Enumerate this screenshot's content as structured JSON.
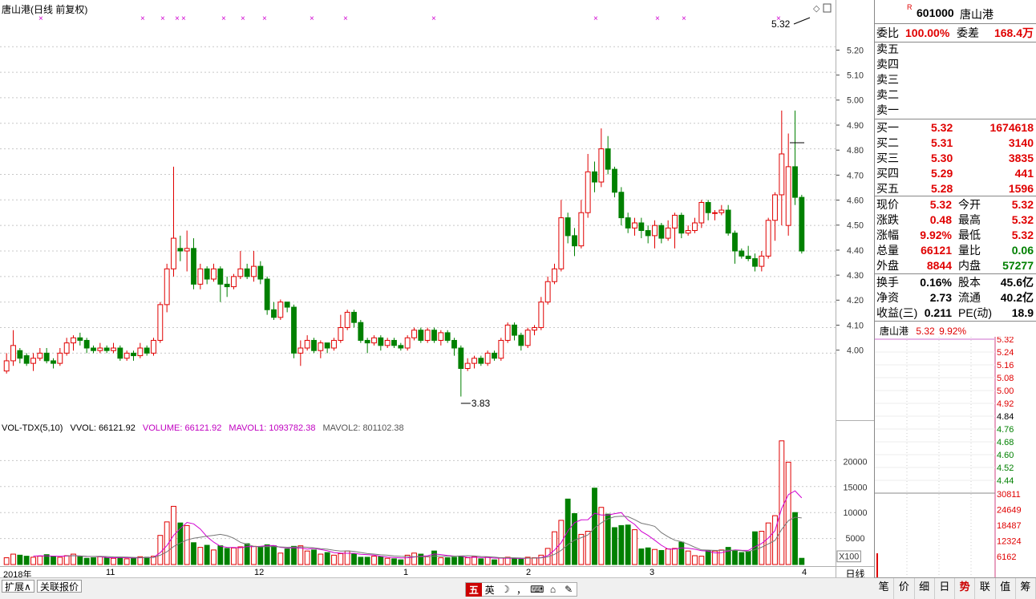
{
  "chart_title": "唐山港(日线 前复权)",
  "last_price_tag": "5.32",
  "low_tag": "3.83",
  "price_ticks": [
    "5.20",
    "5.10",
    "5.00",
    "4.90",
    "4.80",
    "4.70",
    "4.60",
    "4.50",
    "4.40",
    "4.30",
    "4.20",
    "4.10",
    "4.00"
  ],
  "vol_legend": {
    "name": "VOL-TDX(5,10)",
    "vvol": "VVOL: 66121.92",
    "volume": "VOLUME: 66121.92",
    "mavol1": "MAVOL1: 1093782.38",
    "mavol2": "MAVOL2: 801102.38"
  },
  "vol_ticks": [
    "20000",
    "15000",
    "10000",
    "5000"
  ],
  "vol_unit": "X100",
  "date_labels": [
    "2018年",
    "11",
    "12",
    "1",
    "2",
    "3",
    "4"
  ],
  "period_label": "日线",
  "bottom_tabs": [
    "扩展∧",
    "关联报价"
  ],
  "ime": [
    "五",
    "英",
    "☽",
    "，",
    "⌨",
    "⌂",
    "✎"
  ],
  "quote": {
    "badge": "R",
    "code": "601000",
    "name": "唐山港",
    "weibi_label": "委比",
    "weibi": "100.00%",
    "weicha_label": "委差",
    "weicha": "168.4万",
    "sell": [
      "卖五",
      "卖四",
      "卖三",
      "卖二",
      "卖一"
    ],
    "buy": [
      {
        "label": "买一",
        "price": "5.32",
        "vol": "1674618"
      },
      {
        "label": "买二",
        "price": "5.31",
        "vol": "3140"
      },
      {
        "label": "买三",
        "price": "5.30",
        "vol": "3835"
      },
      {
        "label": "买四",
        "price": "5.29",
        "vol": "441"
      },
      {
        "label": "买五",
        "price": "5.28",
        "vol": "1596"
      }
    ],
    "stats": [
      {
        "l1": "现价",
        "v1": "5.32",
        "l2": "今开",
        "v2": "5.32"
      },
      {
        "l1": "涨跌",
        "v1": "0.48",
        "l2": "最高",
        "v2": "5.32"
      },
      {
        "l1": "涨幅",
        "v1": "9.92%",
        "l2": "最低",
        "v2": "5.32"
      },
      {
        "l1": "总量",
        "v1": "66121",
        "l2": "量比",
        "v2": "0.06"
      },
      {
        "l1": "外盘",
        "v1": "8844",
        "l2": "内盘",
        "v2": "57277"
      }
    ],
    "extra": [
      {
        "l1": "换手",
        "v1": "0.16%",
        "l2": "股本",
        "v2": "45.6亿"
      },
      {
        "l1": "净资",
        "v1": "2.73",
        "l2": "流通",
        "v2": "40.2亿"
      },
      {
        "l1": "收益(三)",
        "v1": "0.211",
        "l2": "PE(动)",
        "v2": "18.9"
      }
    ],
    "mini_title_name": "唐山港",
    "mini_title_price": "5.32",
    "mini_title_pct": "9.92%",
    "mini_price_ticks": [
      "5.32",
      "5.24",
      "5.16",
      "5.08",
      "5.00",
      "4.92",
      "4.84",
      "4.76",
      "4.68",
      "4.60",
      "4.52",
      "4.44"
    ],
    "mini_vol_ticks": [
      "30811",
      "24649",
      "18487",
      "12324",
      "6162"
    ],
    "tabs": [
      "笔",
      "价",
      "细",
      "日",
      "势",
      "联",
      "值",
      "筹"
    ]
  },
  "chart_data": {
    "type": "candlestick",
    "title": "唐山港(日线 前复权)",
    "ylim": [
      3.75,
      5.32
    ],
    "candles": [
      [
        3.93,
        3.97,
        3.92,
        4.0
      ],
      [
        3.97,
        4.03,
        3.95,
        4.09
      ],
      [
        4.01,
        3.98,
        3.96,
        4.02
      ],
      [
        3.99,
        3.96,
        3.95,
        4.0
      ],
      [
        3.96,
        3.98,
        3.93,
        4.0
      ],
      [
        3.98,
        4.0,
        3.97,
        4.02
      ],
      [
        4.0,
        3.97,
        3.96,
        4.02
      ],
      [
        3.97,
        3.96,
        3.94,
        3.98
      ],
      [
        3.96,
        4.0,
        3.95,
        4.02
      ],
      [
        4.0,
        4.04,
        3.99,
        4.06
      ],
      [
        4.04,
        4.06,
        4.01,
        4.07
      ],
      [
        4.06,
        4.05,
        4.03,
        4.08
      ],
      [
        4.05,
        4.02,
        4.0,
        4.06
      ],
      [
        4.02,
        4.01,
        4.0,
        4.03
      ],
      [
        4.01,
        4.02,
        4.0,
        4.04
      ],
      [
        4.02,
        4.01,
        4.0,
        4.03
      ],
      [
        4.01,
        4.02,
        4.0,
        4.04
      ],
      [
        4.02,
        3.98,
        3.97,
        4.03
      ],
      [
        3.98,
        4.0,
        3.97,
        4.01
      ],
      [
        4.0,
        3.99,
        3.97,
        4.01
      ],
      [
        3.99,
        4.02,
        3.98,
        4.04
      ],
      [
        4.02,
        4.0,
        3.99,
        4.03
      ],
      [
        4.0,
        4.05,
        3.99,
        4.06
      ],
      [
        4.05,
        4.19,
        4.04,
        4.2
      ],
      [
        4.19,
        4.33,
        4.16,
        4.35
      ],
      [
        4.33,
        4.45,
        4.3,
        4.73
      ],
      [
        4.41,
        4.4,
        4.36,
        4.46
      ],
      [
        4.4,
        4.41,
        4.32,
        4.48
      ],
      [
        4.41,
        4.27,
        4.25,
        4.45
      ],
      [
        4.27,
        4.33,
        4.25,
        4.35
      ],
      [
        4.33,
        4.29,
        4.27,
        4.34
      ],
      [
        4.29,
        4.33,
        4.28,
        4.35
      ],
      [
        4.33,
        4.27,
        4.2,
        4.34
      ],
      [
        4.27,
        4.26,
        4.22,
        4.3
      ],
      [
        4.26,
        4.3,
        4.25,
        4.31
      ],
      [
        4.3,
        4.33,
        4.29,
        4.4
      ],
      [
        4.33,
        4.3,
        4.29,
        4.35
      ],
      [
        4.3,
        4.34,
        4.28,
        4.4
      ],
      [
        4.34,
        4.29,
        4.27,
        4.36
      ],
      [
        4.29,
        4.17,
        4.15,
        4.3
      ],
      [
        4.17,
        4.14,
        4.13,
        4.2
      ],
      [
        4.14,
        4.2,
        4.13,
        4.21
      ],
      [
        4.2,
        4.18,
        4.16,
        4.2
      ],
      [
        4.18,
        4.0,
        3.98,
        4.19
      ],
      [
        4.0,
        4.02,
        3.95,
        4.05
      ],
      [
        4.02,
        4.05,
        4.01,
        4.07
      ],
      [
        4.05,
        4.01,
        4.0,
        4.06
      ],
      [
        4.01,
        4.04,
        3.98,
        4.05
      ],
      [
        4.04,
        4.02,
        4.0,
        4.04
      ],
      [
        4.02,
        4.05,
        4.01,
        4.06
      ],
      [
        4.05,
        4.1,
        4.04,
        4.15
      ],
      [
        4.1,
        4.16,
        4.09,
        4.17
      ],
      [
        4.16,
        4.12,
        4.1,
        4.17
      ],
      [
        4.12,
        4.05,
        4.04,
        4.13
      ],
      [
        4.05,
        4.04,
        4.0,
        4.06
      ],
      [
        4.04,
        4.06,
        4.03,
        4.07
      ],
      [
        4.06,
        4.03,
        4.01,
        4.07
      ],
      [
        4.03,
        4.05,
        4.02,
        4.06
      ],
      [
        4.05,
        4.03,
        4.02,
        4.06
      ],
      [
        4.03,
        4.02,
        4.01,
        4.04
      ],
      [
        4.02,
        4.06,
        4.01,
        4.07
      ],
      [
        4.06,
        4.09,
        4.05,
        4.1
      ],
      [
        4.09,
        4.05,
        4.04,
        4.1
      ],
      [
        4.05,
        4.09,
        4.04,
        4.1
      ],
      [
        4.09,
        4.05,
        4.04,
        4.1
      ],
      [
        4.05,
        4.08,
        4.03,
        4.09
      ],
      [
        4.08,
        4.05,
        4.04,
        4.09
      ],
      [
        4.05,
        4.02,
        3.99,
        4.06
      ],
      [
        4.02,
        3.94,
        3.83,
        4.03
      ],
      [
        3.94,
        3.96,
        3.93,
        3.98
      ],
      [
        3.96,
        3.98,
        3.94,
        3.99
      ],
      [
        3.98,
        3.96,
        3.95,
        3.99
      ],
      [
        3.96,
        4.0,
        3.95,
        4.01
      ],
      [
        4.0,
        3.98,
        3.97,
        4.01
      ],
      [
        3.98,
        4.05,
        3.97,
        4.06
      ],
      [
        4.05,
        4.11,
        4.04,
        4.12
      ],
      [
        4.11,
        4.07,
        4.05,
        4.12
      ],
      [
        4.07,
        4.03,
        4.01,
        4.08
      ],
      [
        4.03,
        4.09,
        4.02,
        4.1
      ],
      [
        4.09,
        4.1,
        4.07,
        4.11
      ],
      [
        4.1,
        4.2,
        4.09,
        4.22
      ],
      [
        4.2,
        4.28,
        4.19,
        4.3
      ],
      [
        4.28,
        4.33,
        4.27,
        4.35
      ],
      [
        4.33,
        4.53,
        4.32,
        4.6
      ],
      [
        4.53,
        4.46,
        4.43,
        4.55
      ],
      [
        4.46,
        4.42,
        4.38,
        4.49
      ],
      [
        4.42,
        4.55,
        4.41,
        4.6
      ],
      [
        4.55,
        4.71,
        4.53,
        4.78
      ],
      [
        4.71,
        4.67,
        4.63,
        4.75
      ],
      [
        4.67,
        4.8,
        4.65,
        4.88
      ],
      [
        4.8,
        4.72,
        4.7,
        4.85
      ],
      [
        4.72,
        4.63,
        4.61,
        4.73
      ],
      [
        4.63,
        4.53,
        4.5,
        4.65
      ],
      [
        4.53,
        4.49,
        4.47,
        4.55
      ],
      [
        4.49,
        4.51,
        4.46,
        4.53
      ],
      [
        4.51,
        4.48,
        4.45,
        4.53
      ],
      [
        4.48,
        4.46,
        4.43,
        4.5
      ],
      [
        4.46,
        4.5,
        4.41,
        4.52
      ],
      [
        4.5,
        4.45,
        4.43,
        4.51
      ],
      [
        4.45,
        4.49,
        4.44,
        4.52
      ],
      [
        4.49,
        4.54,
        4.41,
        4.55
      ],
      [
        4.54,
        4.47,
        4.45,
        4.55
      ],
      [
        4.47,
        4.48,
        4.46,
        4.5
      ],
      [
        4.48,
        4.51,
        4.47,
        4.53
      ],
      [
        4.51,
        4.59,
        4.49,
        4.6
      ],
      [
        4.59,
        4.55,
        4.52,
        4.6
      ],
      [
        4.55,
        4.55,
        4.52,
        4.56
      ],
      [
        4.55,
        4.56,
        4.54,
        4.58
      ],
      [
        4.56,
        4.47,
        4.46,
        4.58
      ],
      [
        4.47,
        4.4,
        4.35,
        4.48
      ],
      [
        4.4,
        4.38,
        4.37,
        4.41
      ],
      [
        4.38,
        4.37,
        4.36,
        4.42
      ],
      [
        4.37,
        4.34,
        4.32,
        4.39
      ],
      [
        4.34,
        4.38,
        4.32,
        4.4
      ],
      [
        4.38,
        4.52,
        4.37,
        4.53
      ],
      [
        4.52,
        4.62,
        4.44,
        4.63
      ],
      [
        4.62,
        4.78,
        4.5,
        4.95
      ],
      [
        4.5,
        4.73,
        4.46,
        4.86
      ],
      [
        4.73,
        4.61,
        4.58,
        4.95
      ],
      [
        4.61,
        4.4,
        4.39,
        4.62
      ]
    ],
    "volume": [
      1300,
      2000,
      1800,
      1600,
      1400,
      1600,
      1900,
      1600,
      1400,
      1700,
      2000,
      1500,
      1200,
      1300,
      1500,
      1300,
      1200,
      1400,
      1100,
      1300,
      1500,
      1400,
      1600,
      5600,
      8200,
      11200,
      8000,
      7500,
      4200,
      3300,
      3700,
      2800,
      3600,
      3100,
      3200,
      3400,
      4000,
      3500,
      3400,
      3800,
      3600,
      2200,
      3000,
      3500,
      3600,
      2600,
      2800,
      2000,
      2300,
      1800,
      2100,
      2600,
      2000,
      1400,
      1400,
      1600,
      1500,
      1200,
      1100,
      900,
      1800,
      2200,
      2000,
      1500,
      2600,
      1300,
      1300,
      1400,
      1500,
      1300,
      1500,
      1100,
      1400,
      900,
      1300,
      1400,
      1100,
      1000,
      1400,
      1300,
      1800,
      3100,
      6300,
      8500,
      12600,
      9800,
      5800,
      6400,
      14700,
      11000,
      9700,
      7100,
      7500,
      7600,
      6700,
      3000,
      3200,
      2900,
      2700,
      3000,
      3100,
      4300,
      2600,
      1700,
      1600,
      2700,
      2600,
      2800,
      3300,
      2700,
      2300,
      2500,
      6300,
      6400,
      8000,
      9400,
      23800,
      19700,
      10000,
      1200
    ]
  }
}
